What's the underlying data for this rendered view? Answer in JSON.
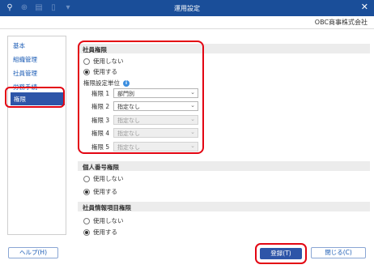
{
  "window": {
    "title": "運用設定",
    "company": "OBC商事株式会社",
    "toolbar_icons": [
      "user-add-icon",
      "zoom-icon",
      "print-icon",
      "document-icon",
      "chevron-down-icon"
    ],
    "close_glyph": "✕"
  },
  "sidebar": {
    "items": [
      {
        "label": "基本"
      },
      {
        "label": "組織管理"
      },
      {
        "label": "社員管理"
      },
      {
        "label": "労務手続"
      },
      {
        "label": "権限",
        "active": true
      }
    ]
  },
  "sections": {
    "employee_permission": {
      "title": "社員権限",
      "options": [
        "使用しない",
        "使用する"
      ],
      "selected": 1,
      "unit_label": "権限設定単位",
      "rows": [
        {
          "label": "権限 1",
          "value": "部門別",
          "disabled": false
        },
        {
          "label": "権限 2",
          "value": "指定なし",
          "disabled": false
        },
        {
          "label": "権限 3",
          "value": "指定なし",
          "disabled": true
        },
        {
          "label": "権限 4",
          "value": "指定なし",
          "disabled": true
        },
        {
          "label": "権限 5",
          "value": "指定なし",
          "disabled": true
        }
      ]
    },
    "personal_number": {
      "title": "個人番号権限",
      "options": [
        "使用しない",
        "使用する"
      ],
      "selected": 1
    },
    "employee_info_items": {
      "title": "社員情報項目権限",
      "options": [
        "使用しない",
        "使用する"
      ],
      "selected": 1
    }
  },
  "footer": {
    "help_label": "ヘルプ(H)",
    "register_label": "登録(T)",
    "close_label": "閉じる(C)"
  },
  "colors": {
    "titlebar": "#1a4e99",
    "accent": "#2e55a8",
    "highlight": "#e30613"
  }
}
